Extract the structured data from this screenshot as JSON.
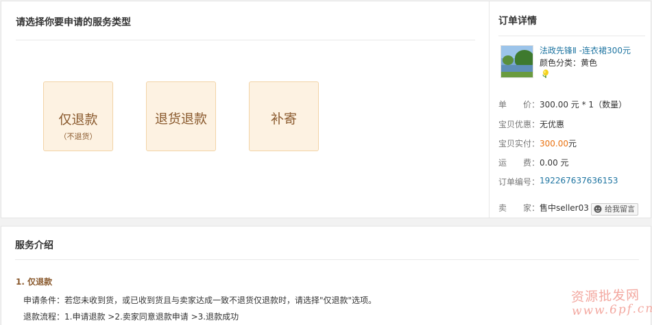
{
  "service": {
    "title": "请选择你要申请的服务类型",
    "options": [
      {
        "label": "仅退款",
        "sublabel": "（不退货）"
      },
      {
        "label": "退货退款",
        "sublabel": ""
      },
      {
        "label": "补寄",
        "sublabel": ""
      }
    ]
  },
  "order": {
    "title": "订单详情",
    "product_name": "法政先锋Ⅱ -连衣裙300元",
    "color_line": "颜色分类：黄色",
    "rows": [
      {
        "label": "单　　价：",
        "value": "300.00 元 * 1（数量）"
      },
      {
        "label": "宝贝优惠：",
        "value": "无优惠"
      },
      {
        "label": "宝贝实付：",
        "value": "300.00",
        "unit": "元"
      },
      {
        "label": "运　　费：",
        "value": "0.00 元"
      },
      {
        "label": "订单编号：",
        "value": "192267637636153"
      },
      {
        "label": "卖　　家：",
        "value": "售中seller03"
      }
    ],
    "message_button": "给我留言"
  },
  "intro": {
    "title": "服务介绍",
    "heading": "1. 仅退款",
    "condition": "申请条件：若您未收到货，或已收到货且与卖家达成一致不退货仅退款时，请选择\"仅退款\"选项。",
    "process": "退款流程：1.申请退款 >2.卖家同意退款申请 >3.退款成功"
  },
  "watermark": {
    "line1": "资源批发网",
    "line2": "www.6pf.cn"
  },
  "colors": {
    "accent_orange": "#e96f0c",
    "link_blue": "#1c73a0",
    "button_bg": "#fdf2e2",
    "button_border": "#f2d3a6"
  }
}
